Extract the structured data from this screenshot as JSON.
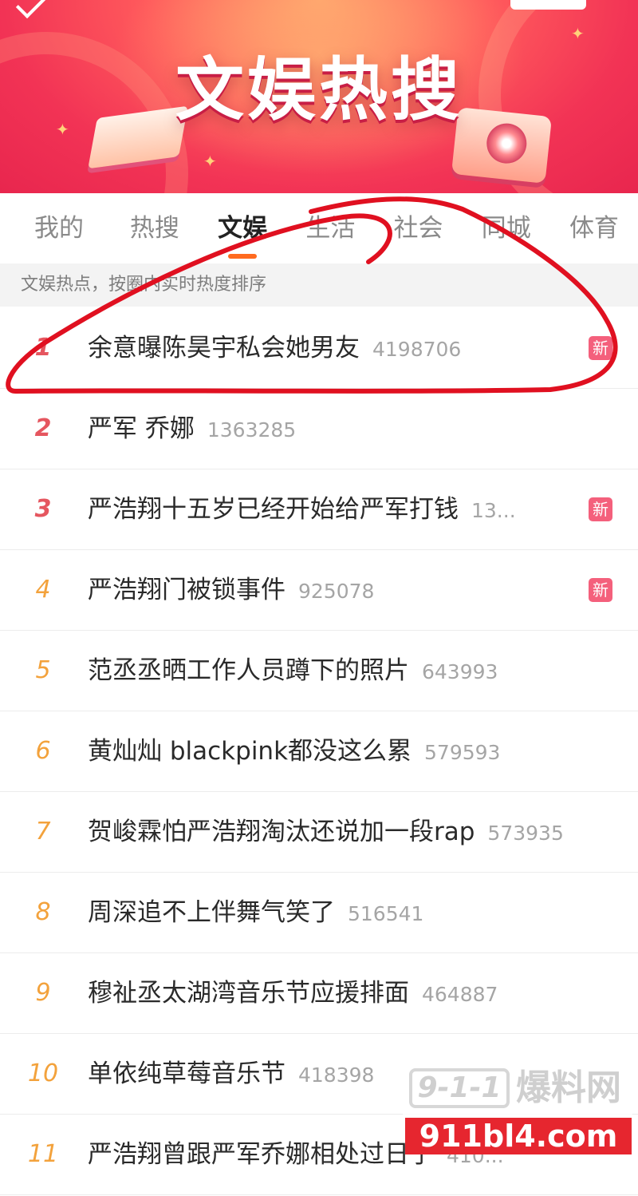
{
  "banner": {
    "title": "文娱热搜"
  },
  "tabs": [
    {
      "label": "我的",
      "active": false
    },
    {
      "label": "热搜",
      "active": false
    },
    {
      "label": "文娱",
      "active": true
    },
    {
      "label": "生活",
      "active": false
    },
    {
      "label": "社会",
      "active": false
    },
    {
      "label": "同城",
      "active": false
    },
    {
      "label": "体育",
      "active": false
    }
  ],
  "info_strip": "文娱热点，按圈内实时热度排序",
  "list": [
    {
      "rank": "1",
      "title": "余意曝陈昊宇私会她男友",
      "heat": "4198706",
      "badge": "新"
    },
    {
      "rank": "2",
      "title": "严军 乔娜",
      "heat": "1363285",
      "badge": ""
    },
    {
      "rank": "3",
      "title": "严浩翔十五岁已经开始给严军打钱",
      "heat": "13...",
      "badge": "新"
    },
    {
      "rank": "4",
      "title": "严浩翔门被锁事件",
      "heat": "925078",
      "badge": "新"
    },
    {
      "rank": "5",
      "title": "范丞丞晒工作人员蹲下的照片",
      "heat": "643993",
      "badge": ""
    },
    {
      "rank": "6",
      "title": "黄灿灿 blackpink都没这么累",
      "heat": "579593",
      "badge": ""
    },
    {
      "rank": "7",
      "title": "贺峻霖怕严浩翔淘汰还说加一段rap",
      "heat": "573935",
      "badge": ""
    },
    {
      "rank": "8",
      "title": "周深追不上伴舞气笑了",
      "heat": "516541",
      "badge": ""
    },
    {
      "rank": "9",
      "title": "穆祉丞太湖湾音乐节应援排面",
      "heat": "464887",
      "badge": ""
    },
    {
      "rank": "10",
      "title": "单依纯草莓音乐节",
      "heat": "418398",
      "badge": ""
    },
    {
      "rank": "11",
      "title": "严浩翔曾跟严军乔娜相处过日子",
      "heat": "410...",
      "badge": ""
    }
  ],
  "watermark": {
    "logo": "9-1-1",
    "name": "爆料网",
    "url": "911bl4.com"
  },
  "colors": {
    "accent": "#ff6a1f",
    "rank_top": "#e5565f",
    "rank_other": "#f3a23c",
    "badge_new": "#f4607c",
    "annotation": "#e01020"
  }
}
